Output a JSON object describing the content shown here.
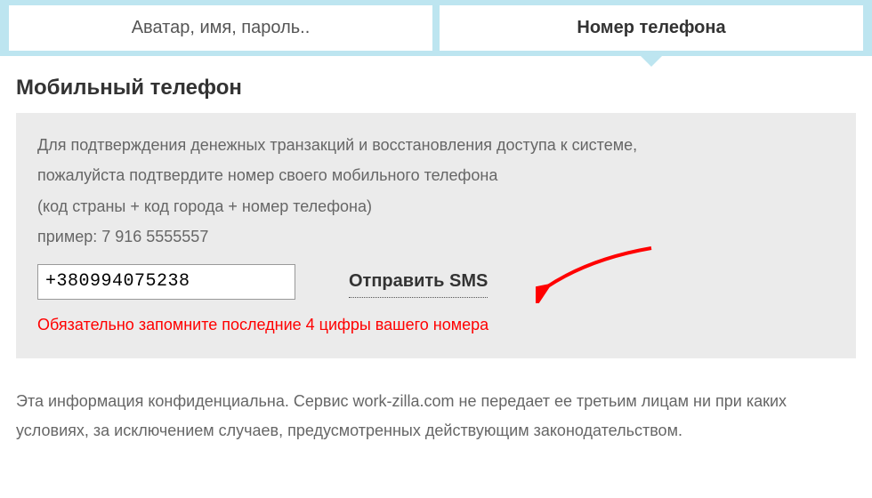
{
  "tabs": {
    "avatar": "Аватар, имя, пароль..",
    "phone": "Номер телефона"
  },
  "section": {
    "title": "Мобильный телефон"
  },
  "info": {
    "line1": "Для подтверждения денежных транзакций и восстановления доступа к системе,",
    "line2": "пожалуйста подтвердите номер своего мобильного телефона",
    "line3": "(код страны + код города + номер телефона)",
    "line4": "пример: 7 916 5555557"
  },
  "form": {
    "phone_value": "+380994075238",
    "send_sms_label": "Отправить SMS"
  },
  "warning": "Обязательно запомните последние 4 цифры вашего номера",
  "footer": "Эта информация конфиденциальна. Сервис work-zilla.com не передает ее третьим лицам ни при каких условиях, за исключением случаев, предусмотренных действующим законодательством."
}
